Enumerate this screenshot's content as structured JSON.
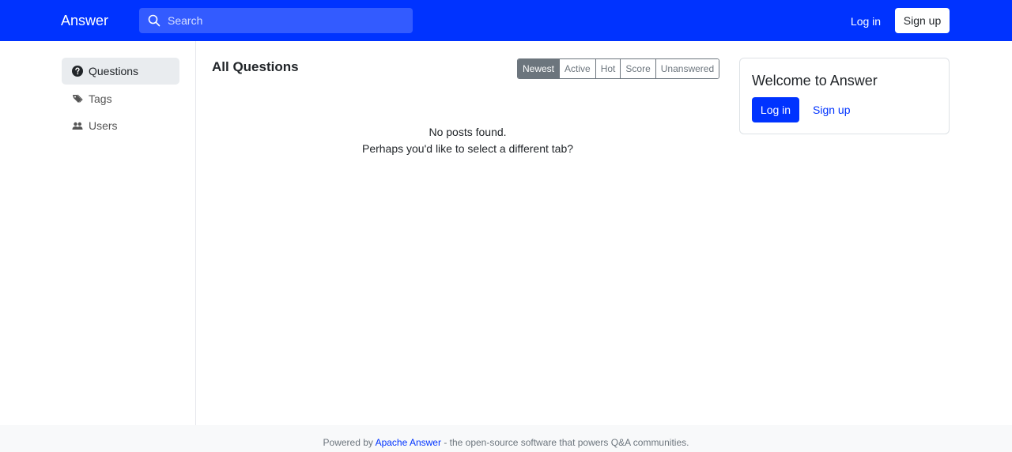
{
  "navbar": {
    "brand": "Answer",
    "search_placeholder": "Search",
    "login_label": "Log in",
    "signup_label": "Sign up",
    "color": "#0033ff"
  },
  "sidebar": {
    "items": [
      {
        "label": "Questions",
        "icon": "question-circle-icon",
        "active": true
      },
      {
        "label": "Tags",
        "icon": "tags-icon",
        "active": false
      },
      {
        "label": "Users",
        "icon": "people-icon",
        "active": false
      }
    ]
  },
  "main": {
    "title": "All Questions",
    "tabs": [
      {
        "label": "Newest",
        "active": true
      },
      {
        "label": "Active",
        "active": false
      },
      {
        "label": "Hot",
        "active": false
      },
      {
        "label": "Score",
        "active": false
      },
      {
        "label": "Unanswered",
        "active": false
      }
    ],
    "empty_line1": "No posts found.",
    "empty_line2": "Perhaps you'd like to select a different tab?"
  },
  "welcome_card": {
    "title": "Welcome to Answer",
    "login_label": "Log in",
    "signup_label": "Sign up"
  },
  "footer": {
    "prefix": "Powered by",
    "link_text": "Apache Answer",
    "suffix": "- the open-source software that powers Q&A communities."
  }
}
